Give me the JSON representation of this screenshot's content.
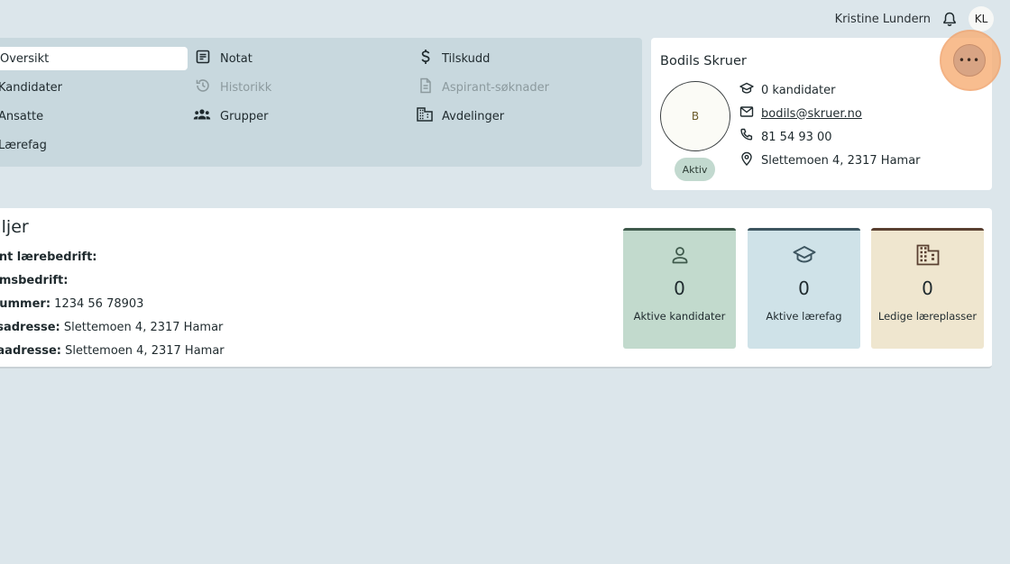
{
  "header": {
    "user_name": "Kristine Lundern",
    "user_initials": "KL"
  },
  "nav": {
    "items": [
      {
        "label": "Oversikt",
        "icon": "none"
      },
      {
        "label": "Notat",
        "icon": "note-icon"
      },
      {
        "label": "Tilskudd",
        "icon": "dollar-icon"
      },
      {
        "label": "Kandidater",
        "icon": "none"
      },
      {
        "label": "Historikk",
        "icon": "history-icon"
      },
      {
        "label": "Aspirant-søknader",
        "icon": "document-icon"
      },
      {
        "label": "Ansatte",
        "icon": "none"
      },
      {
        "label": "Grupper",
        "icon": "group-icon"
      },
      {
        "label": "Avdelinger",
        "icon": "building-icon"
      },
      {
        "label": "Lærefag",
        "icon": "none"
      }
    ]
  },
  "profile": {
    "name": "Bodils Skruer",
    "logo_initial": "B",
    "status": "Aktiv",
    "more_label": "•••",
    "candidates": "0 kandidater",
    "email": "bodils@skruer.no",
    "phone": "81 54 93 00",
    "address": "Slettemoen 4, 2317 Hamar"
  },
  "details": {
    "title": "aljer",
    "lines": [
      {
        "label": "ent lærebedrift:",
        "value": ""
      },
      {
        "label": "emsbedrift:",
        "value": ""
      },
      {
        "label": "nummer:",
        "value": "1234 56 78903"
      },
      {
        "label": "tsadresse:",
        "value": "Slettemoen 4, 2317 Hamar"
      },
      {
        "label": "raadresse:",
        "value": "Slettemoen 4, 2317 Hamar"
      }
    ]
  },
  "stats": [
    {
      "value": "0",
      "label": "Aktive kandidater",
      "icon": "person-icon",
      "bg": "#c2dacd",
      "accent": "#3f5a4c"
    },
    {
      "value": "0",
      "label": "Aktive lærefag",
      "icon": "graduation-cap-icon",
      "bg": "#cfe2e8",
      "accent": "#3d5560"
    },
    {
      "value": "0",
      "label": "Ledige læreplasser",
      "icon": "building-icon",
      "bg": "#efe6cf",
      "accent": "#5a4031"
    }
  ],
  "colors": {
    "page_bg": "#dce6eb",
    "nav_bg": "#c8d8de",
    "highlight": "#f7b27c"
  }
}
